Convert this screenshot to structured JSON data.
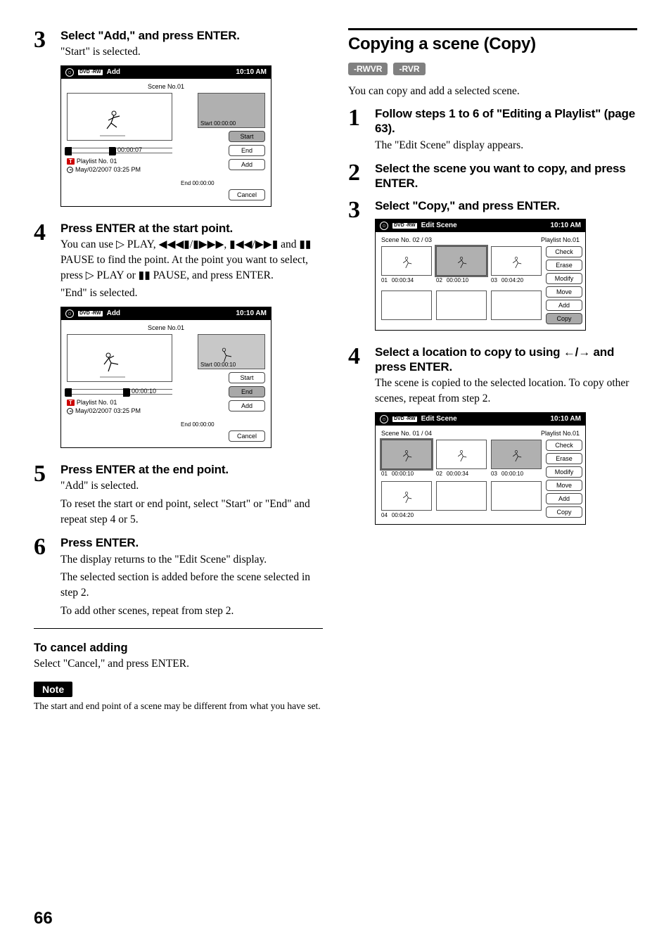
{
  "left": {
    "step3": {
      "num": "3",
      "title": "Select \"Add,\" and press ENTER.",
      "text": "\"Start\" is selected."
    },
    "step4": {
      "num": "4",
      "title": "Press ENTER at the start point.",
      "t1": "You can use ▷ PLAY, ◀◀◀▮/▮▶▶▶, ▮◀◀/▶▶▮ and ▮▮ PAUSE to find the point. At the point you want to select, press ▷ PLAY or ▮▮ PAUSE, and press ENTER.",
      "t2": "\"End\" is selected."
    },
    "step5": {
      "num": "5",
      "title": "Press ENTER at the end point.",
      "t1": "\"Add\" is selected.",
      "t2": "To reset the start or end point, select \"Start\" or \"End\" and repeat step 4 or 5."
    },
    "step6": {
      "num": "6",
      "title": "Press ENTER.",
      "t1": "The display returns to the \"Edit Scene\" display.",
      "t2": "The selected section is added before the scene selected in step 2.",
      "t3": "To add other scenes, repeat from step 2."
    },
    "cancel_head": "To cancel adding",
    "cancel_text": "Select \"Cancel,\" and press ENTER.",
    "note_label": "Note",
    "note_text": "The start and end point of a scene may be different from what you have set.",
    "ui1": {
      "dvd": "DVD -RW",
      "title": "Add",
      "clock": "10:10 AM",
      "scene": "Scene No.01",
      "start_tc": "Start 00:00:00",
      "end_tc": "End   00:00:00",
      "tl_tc": "00:00:07",
      "knob_pos": "60px",
      "playlist": "Playlist No. 01",
      "date": "May/02/2007  03:25  PM",
      "btn_start": "Start",
      "btn_end": "End",
      "btn_add": "Add",
      "btn_cancel": "Cancel",
      "selected": "start"
    },
    "ui2": {
      "dvd": "DVD -RW",
      "title": "Add",
      "clock": "10:10 AM",
      "scene": "Scene No.01",
      "start_tc": "Start 00:00:10",
      "end_tc": "End   00:00:00",
      "tl_tc": "00:00:10",
      "knob_pos": "80px",
      "playlist": "Playlist No. 01",
      "date": "May/02/2007  03:25  PM",
      "btn_start": "Start",
      "btn_end": "End",
      "btn_add": "Add",
      "btn_cancel": "Cancel",
      "selected": "end",
      "thumb_grey": true
    }
  },
  "right": {
    "head": "Copying a scene (Copy)",
    "badges": [
      "-RWVR",
      "-RVR"
    ],
    "lead": "You can copy and add a selected scene.",
    "step1": {
      "num": "1",
      "title": "Follow steps 1 to 6 of \"Editing a Playlist\" (page 63).",
      "text": "The \"Edit Scene\" display appears."
    },
    "step2": {
      "num": "2",
      "title": "Select the scene you want to copy, and press ENTER."
    },
    "step3": {
      "num": "3",
      "title": "Select \"Copy,\" and press ENTER."
    },
    "step4": {
      "num": "4",
      "title_a": "Select a location to copy to using ",
      "title_b": " and press ENTER.",
      "arrows": "←/→",
      "t1": "The scene is copied to the selected location. To copy other scenes, repeat from step 2."
    },
    "ui_es1": {
      "dvd": "DVD -RW",
      "title": "Edit Scene",
      "clock": "10:10 AM",
      "sceneno": "Scene No. 02 / 03",
      "plno": "Playlist No.01",
      "cells": [
        {
          "idx": "01",
          "tc": "00:00:34",
          "grey": false,
          "sel": false
        },
        {
          "idx": "02",
          "tc": "00:00:10",
          "grey": true,
          "sel": true
        },
        {
          "idx": "03",
          "tc": "00:04:20",
          "grey": false,
          "sel": false
        }
      ],
      "btns": [
        "Check",
        "Erase",
        "Modify",
        "Move",
        "Add",
        "Copy"
      ],
      "selected_btn": "Copy"
    },
    "ui_es2": {
      "dvd": "DVD -RW",
      "title": "Edit Scene",
      "clock": "10:10 AM",
      "sceneno": "Scene No. 01 / 04",
      "plno": "Playlist No.01",
      "cells": [
        {
          "idx": "01",
          "tc": "00:00:10",
          "grey": true,
          "sel": true
        },
        {
          "idx": "02",
          "tc": "00:00:34",
          "grey": false,
          "sel": false
        },
        {
          "idx": "03",
          "tc": "00:00:10",
          "grey": true,
          "sel": false
        },
        {
          "idx": "04",
          "tc": "00:04:20",
          "grey": false,
          "sel": false
        }
      ],
      "btns": [
        "Check",
        "Erase",
        "Modify",
        "Move",
        "Add",
        "Copy"
      ],
      "selected_btn": ""
    }
  },
  "page": "66"
}
